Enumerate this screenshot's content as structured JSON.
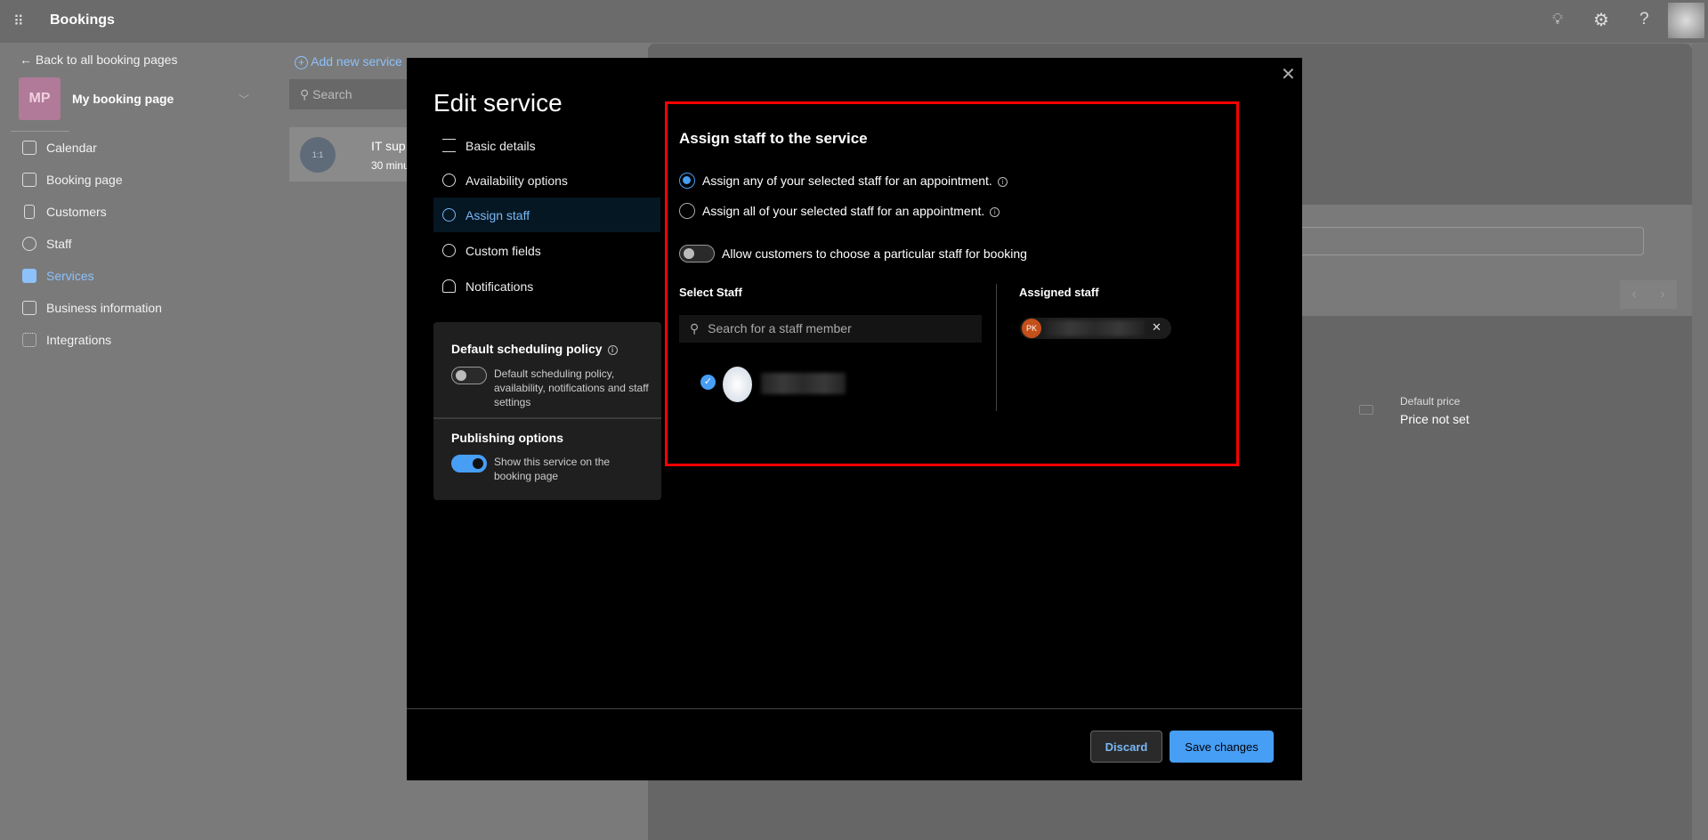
{
  "app": {
    "title": "Bookings",
    "header_icons": [
      "lightbulb-icon",
      "settings-icon",
      "help-icon"
    ]
  },
  "sidebar": {
    "back": "Back to all booking pages",
    "avatar_initials": "MP",
    "page_name": "My booking page",
    "items": [
      {
        "label": "Calendar"
      },
      {
        "label": "Booking page"
      },
      {
        "label": "Customers"
      },
      {
        "label": "Staff"
      },
      {
        "label": "Services",
        "active": true
      },
      {
        "label": "Business information"
      },
      {
        "label": "Integrations"
      }
    ]
  },
  "services": {
    "add_label": "Add new service",
    "search_placeholder": "Search",
    "card_title": "IT sup",
    "card_sub": "30 minu",
    "card_icon_text": "1:1"
  },
  "detail": {
    "price_label": "Default price",
    "price_value": "Price not set"
  },
  "modal": {
    "title": "Edit service",
    "nav": [
      {
        "label": "Basic details"
      },
      {
        "label": "Availability options"
      },
      {
        "label": "Assign staff",
        "active": true
      },
      {
        "label": "Custom fields"
      },
      {
        "label": "Notifications"
      }
    ],
    "policy": {
      "title": "Default scheduling policy",
      "toggle_label": "Default scheduling policy, availability, notifications and staff settings",
      "toggle_on": false
    },
    "publishing": {
      "title": "Publishing options",
      "toggle_label": "Show this service on the booking page",
      "toggle_on": true
    },
    "assign": {
      "title": "Assign staff to the service",
      "radio_any": "Assign any of your selected staff for an appointment.",
      "radio_all": "Assign all of your selected staff for an appointment.",
      "selected": "any",
      "allow_choose": "Allow customers to choose a particular staff for booking",
      "allow_choose_on": false,
      "select_label": "Select Staff",
      "search_placeholder": "Search for a staff member",
      "assigned_label": "Assigned staff",
      "assigned_initials": "PK"
    },
    "discard": "Discard",
    "save": "Save changes"
  },
  "colors": {
    "accent": "#479ef5",
    "highlight": "#ff0000",
    "chip_avatar": "#c4501a",
    "avatar_bg": "#b07a98"
  }
}
